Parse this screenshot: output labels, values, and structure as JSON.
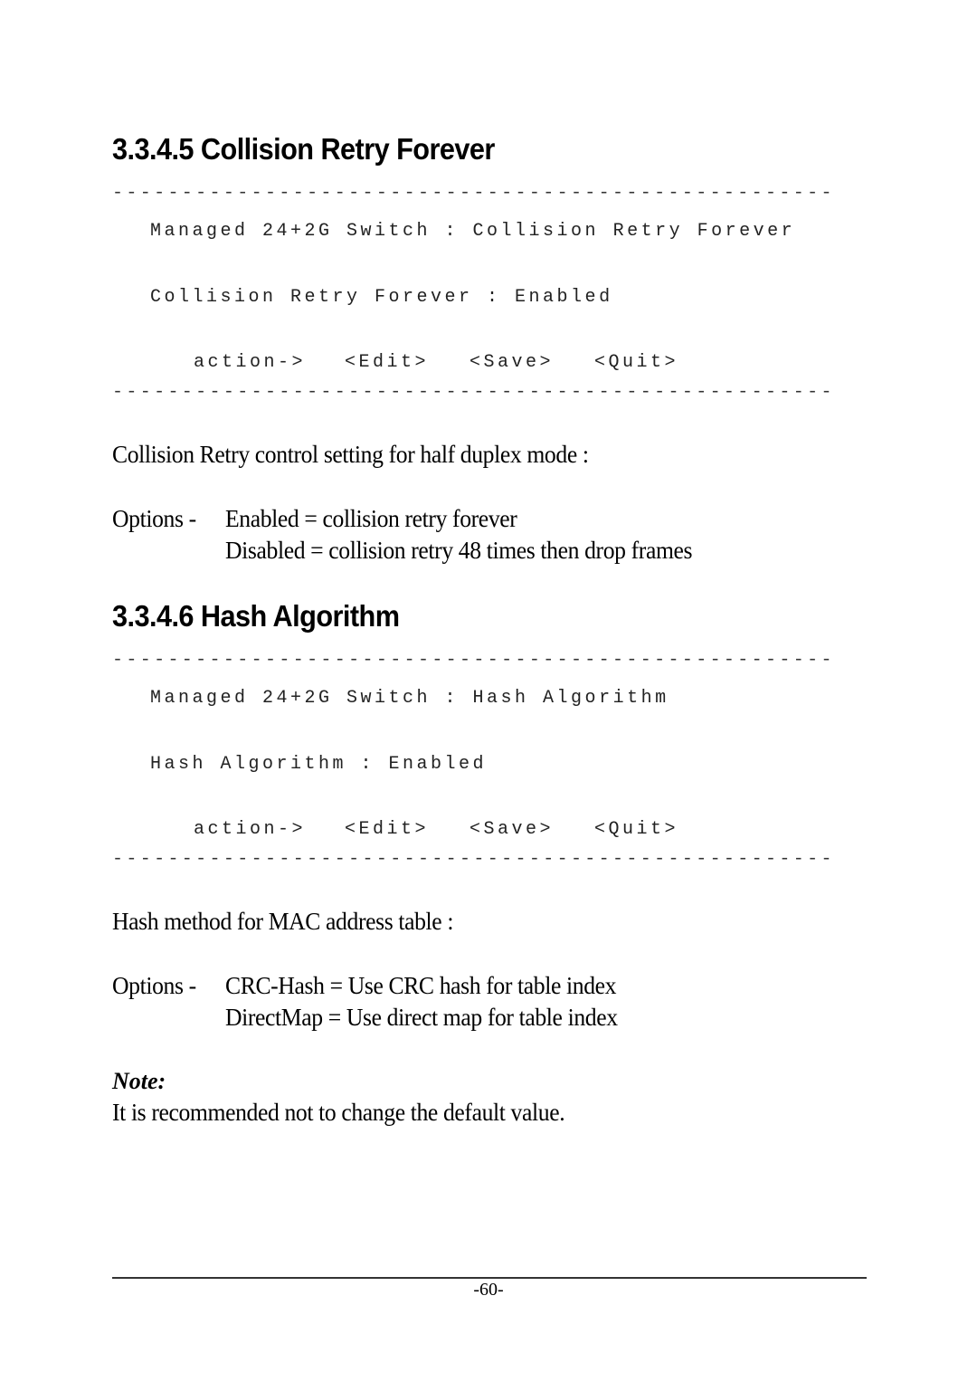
{
  "sections": [
    {
      "heading": "3.3.4.5 Collision Retry Forever",
      "terminal": {
        "separator": "----------------------------------------------------",
        "title_line": "Managed 24+2G Switch : Collision Retry Forever",
        "setting_line": "Collision Retry Forever : Enabled",
        "setting_name": "Collision Retry Forever",
        "setting_value": "Enabled",
        "action_label": "action->",
        "actions": [
          "<Edit>",
          "<Save>",
          "<Quit>"
        ]
      },
      "description": "Collision Retry control setting for half duplex mode :",
      "options_label": "Options -",
      "options": [
        "Enabled = collision retry forever",
        "Disabled = collision retry 48 times then drop frames"
      ]
    },
    {
      "heading": "3.3.4.6 Hash Algorithm",
      "terminal": {
        "separator": "----------------------------------------------------",
        "title_line": "Managed 24+2G Switch : Hash Algorithm",
        "setting_line": "Hash Algorithm : Enabled",
        "setting_name": "Hash Algorithm",
        "setting_value": "Enabled",
        "action_label": "action->",
        "actions": [
          "<Edit>",
          "<Save>",
          "<Quit>"
        ]
      },
      "description": "Hash method for MAC address table :",
      "options_label": "Options -",
      "options": [
        "CRC-Hash = Use CRC hash for table index",
        "DirectMap = Use direct map for table index"
      ]
    }
  ],
  "note": {
    "label": "Note:",
    "text": "It is recommended not to change the default value."
  },
  "footer": {
    "page_number": "-60-"
  }
}
